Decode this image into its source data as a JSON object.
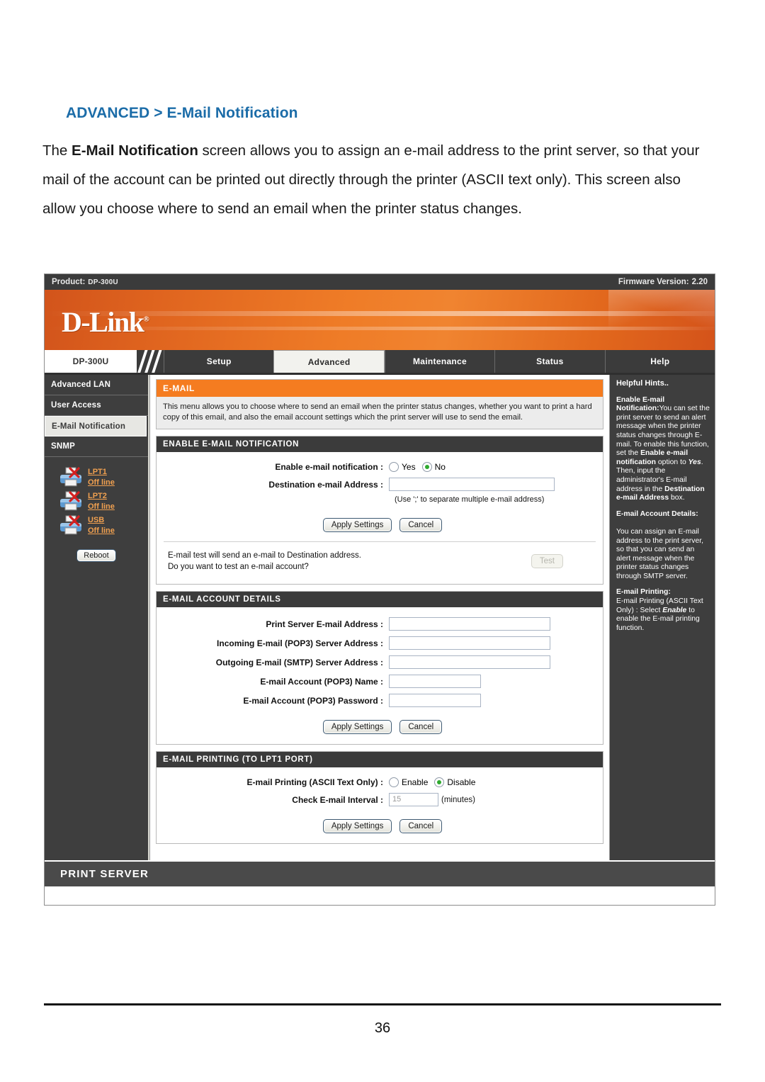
{
  "doc": {
    "heading_prefix": "ADVANCED",
    "heading_sep": ">",
    "heading_page": "E-Mail Notification",
    "para_1": "The ",
    "para_bold": "E-Mail Notification",
    "para_2": " screen allows you to assign an e-mail address to the print server, so that your mail of the account can be printed out directly through the printer (ASCII text only). This screen also allow you choose where to send an email when the printer status changes.",
    "page_number": "36"
  },
  "ui": {
    "product_label": "Product:",
    "product_model": "DP-300U",
    "firmware_label": "Firmware Version:",
    "firmware_value": "2.20",
    "logo": "D-Link",
    "logo_mark": "®",
    "model_badge": "DP-300U",
    "tabs": [
      {
        "label": "Setup",
        "active": false
      },
      {
        "label": "Advanced",
        "active": true
      },
      {
        "label": "Maintenance",
        "active": false
      },
      {
        "label": "Status",
        "active": false
      },
      {
        "label": "Help",
        "active": false
      }
    ],
    "footer": "PRINT SERVER"
  },
  "sidebar": {
    "items": [
      {
        "label": "Advanced LAN",
        "active": false
      },
      {
        "label": "User Access",
        "active": false
      },
      {
        "label": "E-Mail Notification",
        "active": true
      },
      {
        "label": "SNMP",
        "active": false
      }
    ],
    "printers": [
      {
        "port": "LPT1",
        "status": "Off line"
      },
      {
        "port": "LPT2",
        "status": "Off line"
      },
      {
        "port": "USB",
        "status": "Off line"
      }
    ],
    "reboot_label": "Reboot"
  },
  "email_panel": {
    "title": "E-MAIL",
    "description": "This menu allows you to choose where to send an email when the printer status changes, whether you want to print a hard copy of this email, and also the email account settings which the print server will use to send the email."
  },
  "enable_section": {
    "title": "ENABLE E-MAIL NOTIFICATION",
    "enable_label": "Enable e-mail notification :",
    "option_yes": "Yes",
    "option_no": "No",
    "selected": "No",
    "dest_label": "Destination e-mail Address :",
    "dest_value": "",
    "dest_hint": "(Use ';' to separate multiple e-mail address)",
    "apply_label": "Apply Settings",
    "cancel_label": "Cancel",
    "test_text_line1": "E-mail test will send an e-mail to Destination address.",
    "test_text_line2": "Do you want to test an e-mail account?",
    "test_label": "Test"
  },
  "account_section": {
    "title": "E-MAIL ACCOUNT DETAILS",
    "fields": [
      {
        "label": "Print Server E-mail Address :",
        "value": "",
        "size": "lg"
      },
      {
        "label": "Incoming E-mail (POP3) Server Address :",
        "value": "",
        "size": "lg"
      },
      {
        "label": "Outgoing E-mail (SMTP) Server Address :",
        "value": "",
        "size": "lg"
      },
      {
        "label": "E-mail Account (POP3) Name :",
        "value": "",
        "size": "sm"
      },
      {
        "label": "E-mail Account (POP3) Password :",
        "value": "",
        "size": "sm"
      }
    ],
    "apply_label": "Apply Settings",
    "cancel_label": "Cancel"
  },
  "printing_section": {
    "title": "E-MAIL PRINTING (TO LPT1 PORT)",
    "printing_label": "E-mail Printing (ASCII Text Only) :",
    "option_enable": "Enable",
    "option_disable": "Disable",
    "selected": "Disable",
    "interval_label": "Check E-mail Interval :",
    "interval_value": "15",
    "interval_unit": "(minutes)",
    "apply_label": "Apply Settings",
    "cancel_label": "Cancel"
  },
  "hints": {
    "title": "Helpful Hints..",
    "h1_title": "Enable E-mail Notification:",
    "h1_a": "You can set the print server to send an alert message when the printer status changes through E-mail. To enable this function, set the ",
    "h1_b": "Enable e-mail notification",
    "h1_c": " option to ",
    "h1_d": "Yes",
    "h1_e": ". Then, input the administrator's E-mail address in the ",
    "h1_f": "Destination e-mail Address",
    "h1_g": " box.",
    "h2_title": "E-mail Account Details:",
    "h2_body": "You can assign an E-mail address to the print server, so that you can send an alert message when the printer status changes through SMTP server.",
    "h3_title": "E-mail Printing:",
    "h3_a": "E-mail Printing (ASCII Text Only) : Select ",
    "h3_b": "Enable",
    "h3_c": " to enable the E-mail printing function."
  },
  "colors": {
    "accent_orange": "#f57c20",
    "heading_blue": "#1b6ca8",
    "dark_chrome": "#3e3e3e",
    "radio_green": "#2faa2f",
    "link_orange": "#f0a050"
  }
}
